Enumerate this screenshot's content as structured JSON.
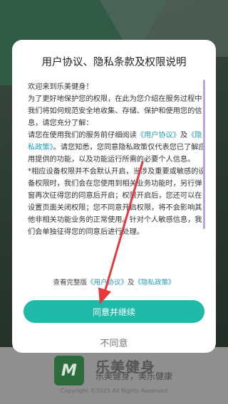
{
  "dialog": {
    "title": "用户协议、隐私条款及权限说明",
    "welcome": "欢迎来到乐美健身！",
    "para1": "为了更好地保护您的权限，在此为您介绍在服务过程中我们将如何规范安全地收集、存储、保护和使用您的信息，请您充分了解：",
    "para2_prefix": "请您在使用我们的服务前仔细阅读",
    "link_user_agreement": "《用户协议》",
    "para2_and": "及",
    "link_privacy_policy": "《隐私政策》",
    "para2_suffix": "。请您知悉，您同意隐私政策仅代表您已了解应用提供的功能，以及功能运行所需的必要个人信息。",
    "para3": "*相应设备权限并不会默认开启，当涉及重要或敏感的设备权限时，我们会在您使用到相关业务功能时，另行弹窗再次征得您的同意后开启；权限开启后，您还可以在设置页面关闭权限；您不同意开启权限，将不会影响其他非相关功能业务的正常使用。针对个人敏感信息，我们会单独征得您的同意后进行处理。",
    "agree_line_prefix": "查看完整版",
    "agree_line_link1": "《用户协议》",
    "agree_line_and": "及",
    "agree_line_link2": "《隐私政策》",
    "agree_button": "同意并继续",
    "disagree_button": "不同意"
  },
  "background": {
    "logo_text": "M",
    "brand": "乐美健身",
    "slogan": "乐美健身，美乐健康",
    "copyright": "Copyright ©2025 All Rights Reserved"
  },
  "colors": {
    "accent": "#1fbba8",
    "link": "#1e9dbd",
    "arrow": "#e8383d"
  }
}
